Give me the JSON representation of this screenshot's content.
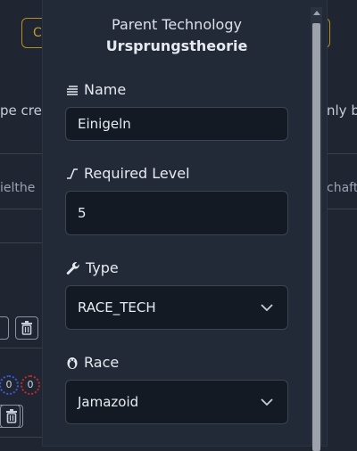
{
  "background": {
    "top_button_label": "C",
    "left_text": "pe cre",
    "right_text": "nly b",
    "left_tab_text": "ielthe",
    "right_tab_text": "chafte",
    "badge_values": [
      "0",
      "0"
    ]
  },
  "modal": {
    "parent_label": "Parent Technology",
    "parent_value": "Ursprungstheorie",
    "name": {
      "label": "Name",
      "value": "Einigeln",
      "icon": "text-lines-icon"
    },
    "level": {
      "label": "Required Level",
      "value": "5",
      "icon": "level-curve-icon"
    },
    "type": {
      "label": "Type",
      "value": "RACE_TECH",
      "icon": "wrench-icon"
    },
    "race": {
      "label": "Race",
      "value": "Jamazoid",
      "icon": "penguin-icon"
    }
  },
  "colors": {
    "modal_bg": "#222a37",
    "input_bg": "#141a24",
    "accent_gold": "#c59a2f"
  }
}
